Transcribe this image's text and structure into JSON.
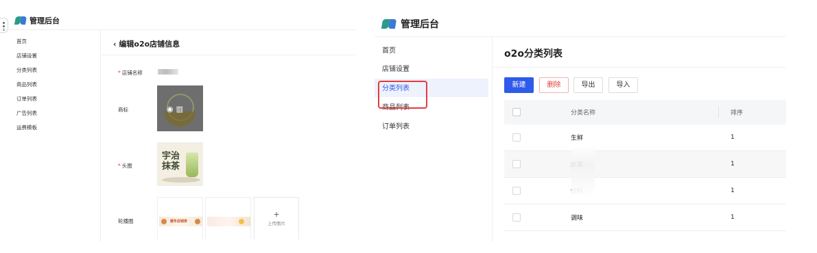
{
  "left_app": {
    "title": "管理后台",
    "sidebar": [
      "首页",
      "店铺设置",
      "分类列表",
      "商品列表",
      "订单列表",
      "广告列表",
      "运费模板"
    ],
    "page_title": "编辑o2o店铺信息",
    "form": {
      "store_name_label": "店铺名称",
      "logo_label": "商标",
      "head_image_label": "头图",
      "carousel_label": "轮播图",
      "required_mark": "*",
      "head_image_text_line1": "宇治",
      "head_image_text_line2": "抹茶",
      "banner_text": "暖冬促销季",
      "upload_plus": "+",
      "upload_label": "上传图片"
    }
  },
  "right_app": {
    "title": "管理后台",
    "sidebar": [
      "首页",
      "店铺设置",
      "分类列表",
      "商品列表",
      "订单列表"
    ],
    "active_item_index": 2,
    "page_title": "o2o分类列表",
    "toolbar": {
      "new": "新建",
      "delete": "删除",
      "export": "导出",
      "import": "导入"
    },
    "table": {
      "headers": [
        "分类名称",
        "排序"
      ],
      "rows": [
        {
          "name": "生鲜",
          "sort": "1"
        },
        {
          "name": "水果",
          "sort": "1"
        },
        {
          "name": "饮料",
          "sort": "1"
        },
        {
          "name": "调味",
          "sort": "1"
        }
      ]
    },
    "colors": {
      "primary": "#2f5bea",
      "danger": "#e23b3b",
      "highlight_box": "#e23b3b"
    }
  }
}
